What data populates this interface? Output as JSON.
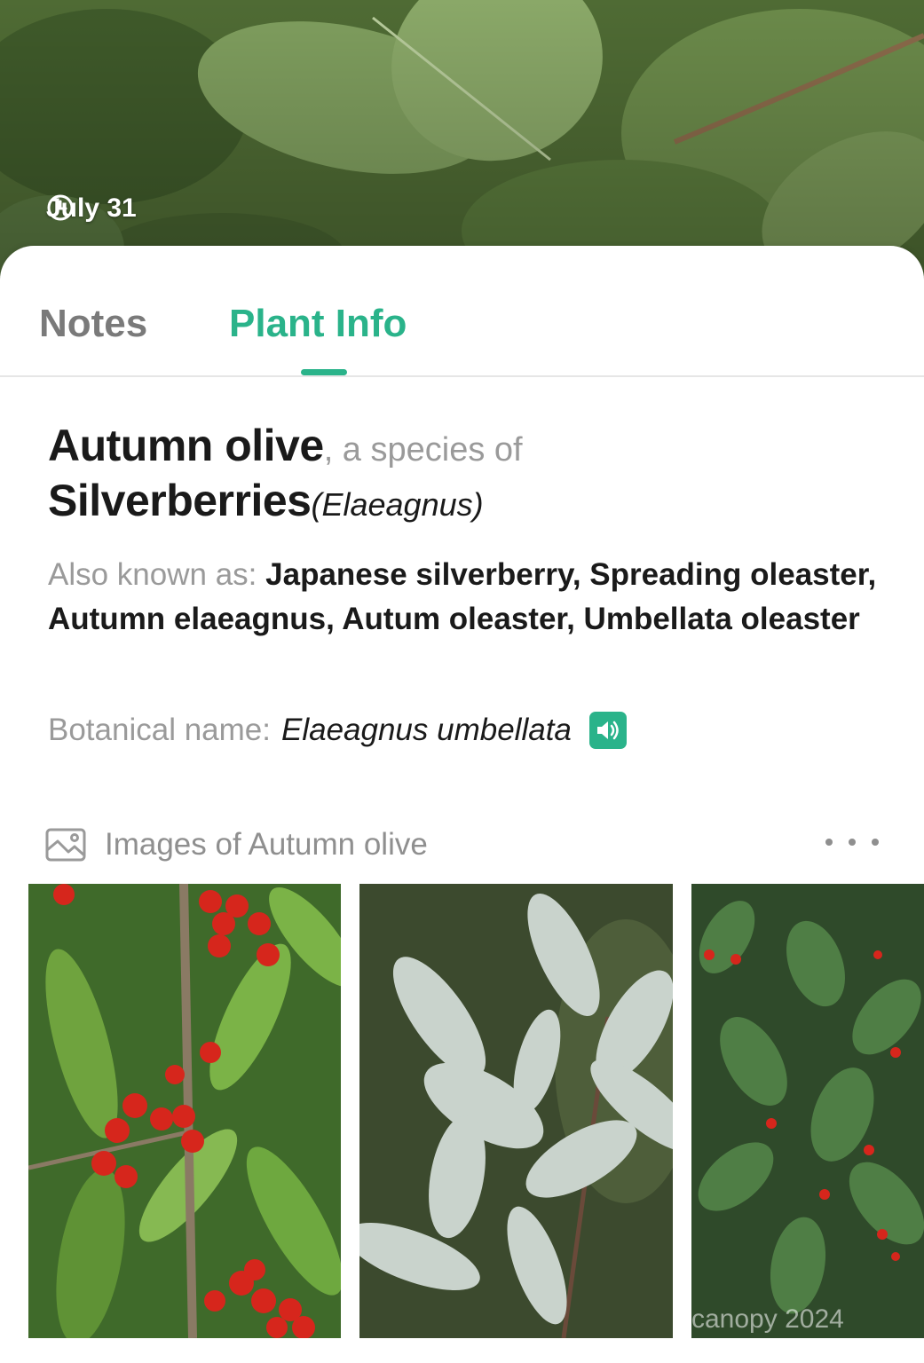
{
  "header": {
    "date": "July 31"
  },
  "tabs": [
    {
      "label": "Notes",
      "active": false
    },
    {
      "label": "Plant Info",
      "active": true
    }
  ],
  "plant": {
    "common_name": "Autumn olive",
    "species_of_text": ", a species of",
    "genus_common": "Silverberries",
    "genus_latin": "(Elaeagnus)",
    "aka_label": "Also known as:",
    "aka_value": "Japanese silverberry, Spreading oleaster, Autumn elaeagnus, Autum oleaster, Umbellata oleaster",
    "botanical_label": "Botanical name:",
    "botanical_value": "Elaeagnus umbellata"
  },
  "images_section": {
    "title": "Images of Autumn olive",
    "watermark": "canopy 2024"
  },
  "colors": {
    "accent": "#2ab38a",
    "text_primary": "#1a1a1a",
    "text_secondary": "#9a9a9a"
  },
  "icons": {
    "date": "clock-icon",
    "pronounce": "speaker-icon",
    "images": "image-gallery-icon",
    "more": "more-dots-icon"
  }
}
